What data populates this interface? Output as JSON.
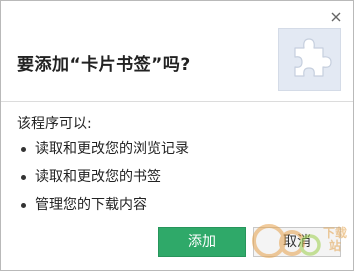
{
  "dialog": {
    "title": "要添加“卡片书签”吗?",
    "extension_icon": "puzzle-piece-icon",
    "close_icon": "close-icon"
  },
  "permissions": {
    "heading": "该程序可以:",
    "items": [
      {
        "label": "读取和更改您的浏览记录"
      },
      {
        "label": "读取和更改您的书签"
      },
      {
        "label": "管理您的下载内容"
      }
    ]
  },
  "buttons": {
    "add_label": "添加",
    "cancel_label": "取消"
  },
  "watermark": {
    "brand": "pc6",
    "line1": "下载",
    "line2": "站"
  },
  "colors": {
    "accent": "#2fa969",
    "icon_bg": "#e3e9f3",
    "icon_fg": "#ffffff"
  }
}
